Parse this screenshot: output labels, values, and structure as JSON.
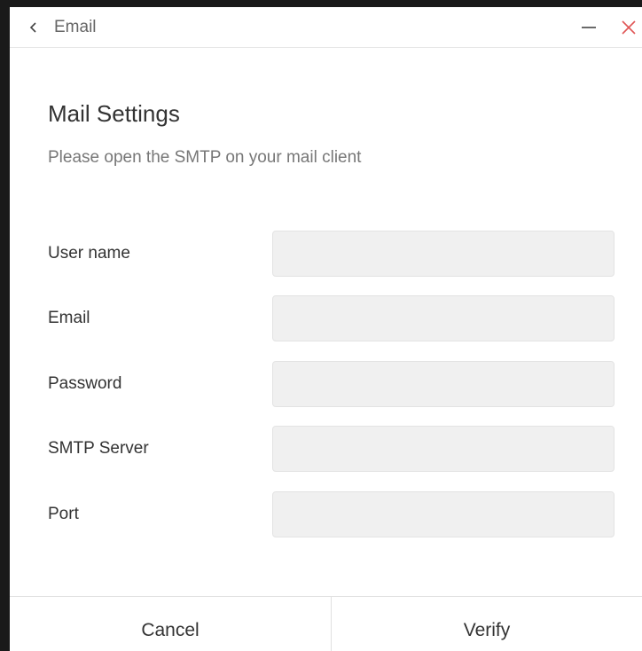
{
  "window": {
    "title": "Email",
    "icons": {
      "back": "chevron-left-icon",
      "minimize": "minimize-icon",
      "close": "close-icon"
    },
    "close_color": "#e05555"
  },
  "main": {
    "heading": "Mail Settings",
    "subtitle": "Please open the SMTP on your mail client"
  },
  "form": {
    "fields": [
      {
        "label": "User name",
        "value": "",
        "placeholder": ""
      },
      {
        "label": "Email",
        "value": "",
        "placeholder": ""
      },
      {
        "label": "Password",
        "value": "",
        "placeholder": ""
      },
      {
        "label": "SMTP Server",
        "value": "",
        "placeholder": ""
      },
      {
        "label": "Port",
        "value": "",
        "placeholder": ""
      }
    ]
  },
  "footer": {
    "cancel_label": "Cancel",
    "verify_label": "Verify"
  }
}
